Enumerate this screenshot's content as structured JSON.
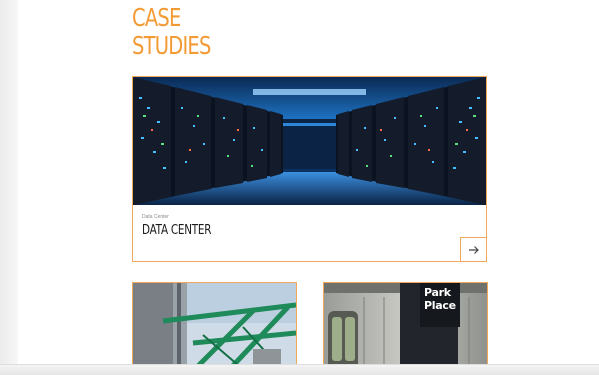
{
  "heading": {
    "line1": "CASE",
    "line2": "STUDIES"
  },
  "feature_card": {
    "category": "Data Center",
    "title": "DATA CENTER",
    "arrow_icon": "arrow-right-icon"
  },
  "small_cards": {
    "left": {
      "image": "industrial-scaffold-photo"
    },
    "right": {
      "image": "subway-train-photo",
      "sign_line1": "Park",
      "sign_line2": "Place"
    }
  },
  "colors": {
    "accent": "#f39a35",
    "border": "#f2a85a"
  }
}
